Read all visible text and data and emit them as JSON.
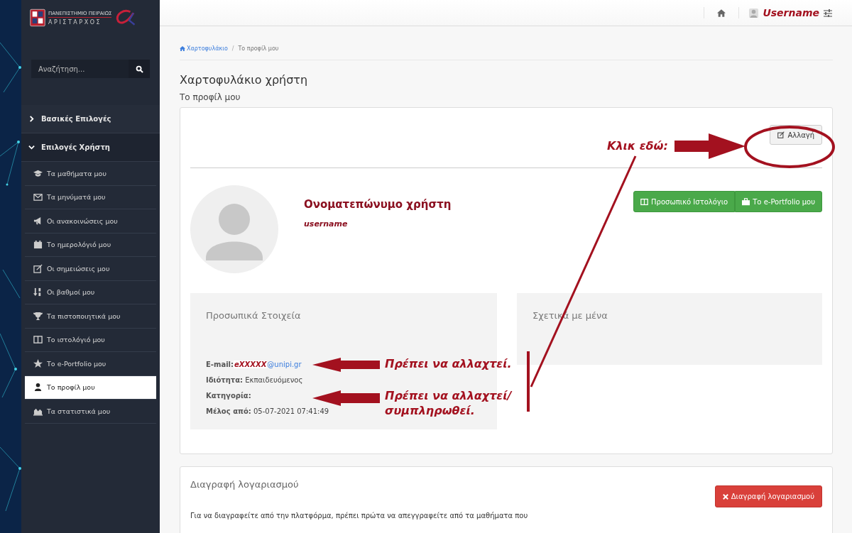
{
  "logo": {
    "university": "ΠΑΝΕΠΙΣΤΗΜΙΟ ΠΕΙΡΑΙΩΣ",
    "system": "Α Ρ Ι Σ Τ Α Ρ Χ Ο Σ"
  },
  "sidebar": {
    "search": {
      "placeholder": "Αναζήτηση..."
    },
    "sections": [
      {
        "label": "Βασικές Επιλογές",
        "expanded": false
      },
      {
        "label": "Επιλογές Χρήστη",
        "expanded": true
      }
    ],
    "items": [
      {
        "label": "Τα μαθήματα μου",
        "selected": false
      },
      {
        "label": "Τα μηνύματά μου",
        "selected": false
      },
      {
        "label": "Οι ανακοινώσεις μου",
        "selected": false
      },
      {
        "label": "Το ημερολόγιό μου",
        "selected": false
      },
      {
        "label": "Οι σημειώσεις μου",
        "selected": false
      },
      {
        "label": "Οι βαθμοί μου",
        "selected": false
      },
      {
        "label": "Τα πιστοποιητικά μου",
        "selected": false
      },
      {
        "label": "Το ιστολόγιό μου",
        "selected": false
      },
      {
        "label": "Το e-Portfolio μου",
        "selected": false
      },
      {
        "label": "Το προφίλ μου",
        "selected": true
      },
      {
        "label": "Τα στατιστικά μου",
        "selected": false
      }
    ]
  },
  "topbar": {
    "username": "Username"
  },
  "breadcrumb": {
    "items": [
      "Χαρτοφυλάκιο",
      "Το προφίλ μου"
    ],
    "separator": "/"
  },
  "title": "Χαρτοφυλάκιο χρήστη",
  "subtitle": "Το προφίλ μου",
  "profile": {
    "edit_button": "Αλλαγή",
    "full_name": "Ονοματεπώνυμο χρήστη",
    "username": "username",
    "buttons": [
      "Προσωπικό Ιστολόγιο",
      "Το e-Portfolio μου"
    ],
    "personal": {
      "heading": "Προσωπικά Στοιχεία",
      "fields": [
        {
          "kind": "email",
          "label": "E-mail:",
          "mask": "eXXXXX",
          "value": "@unipi.gr"
        },
        {
          "kind": "text",
          "label": "Ιδιότητα:",
          "value": "Εκπαιδευόμενος"
        },
        {
          "kind": "text",
          "label": "Κατηγορία:"
        },
        {
          "kind": "text",
          "label": "Μέλος από:",
          "value": "05-07-2021 07:41:49"
        }
      ]
    },
    "about": {
      "heading": "Σχετικά με μένα"
    }
  },
  "delete": {
    "heading": "Διαγραφή λογαριασμού",
    "button": "Διαγραφή λογαριασμού",
    "text": "Για να διαγραφείτε από την πλατφόρμα, πρέπει πρώτα να απεγγραφείτε από τα μαθήματα που"
  },
  "annotations": {
    "click_here": "Κλικ εδώ:",
    "email_note": "Πρέπει να αλλαχτεί.",
    "category_note": "Πρέπει να αλλαχτεί/ συμπληρωθεί."
  }
}
